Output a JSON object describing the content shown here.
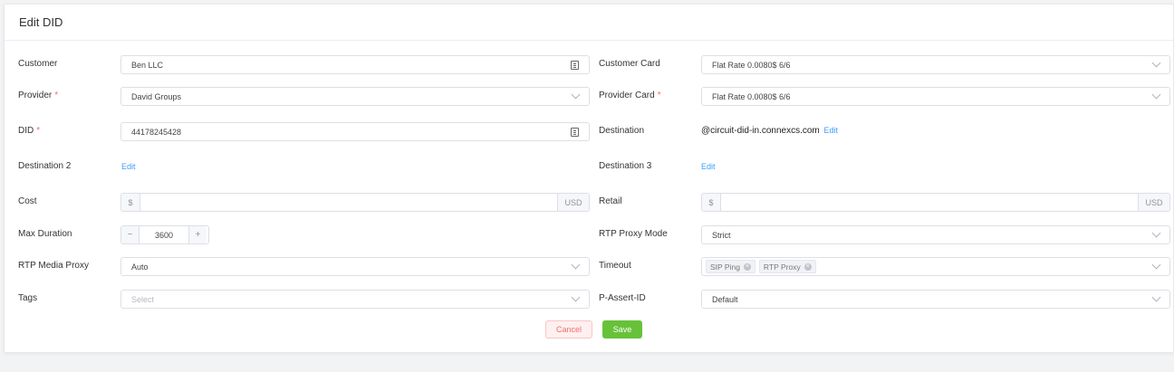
{
  "header": {
    "title": "Edit DID"
  },
  "left": {
    "customer": {
      "label": "Customer",
      "value": "Ben LLC"
    },
    "provider": {
      "label": "Provider",
      "required": "*",
      "value": "David Groups"
    },
    "did": {
      "label": "DID",
      "required": "*",
      "value": "44178245428"
    },
    "destination2": {
      "label": "Destination 2",
      "link": "Edit"
    },
    "cost": {
      "label": "Cost",
      "prefix": "$",
      "value": "",
      "suffix": "USD"
    },
    "max_duration": {
      "label": "Max Duration",
      "minus": "−",
      "value": "3600",
      "plus": "+"
    },
    "rtp_media_proxy": {
      "label": "RTP Media Proxy",
      "value": "Auto"
    },
    "tags": {
      "label": "Tags",
      "placeholder": "Select"
    }
  },
  "right": {
    "customer_card": {
      "label": "Customer Card",
      "value": "Flat Rate 0.0080$ 6/6"
    },
    "provider_card": {
      "label": "Provider Card",
      "required": "*",
      "value": "Flat Rate 0.0080$ 6/6"
    },
    "destination": {
      "label": "Destination",
      "value": "@circuit-did-in.connexcs.com",
      "link": "Edit"
    },
    "destination3": {
      "label": "Destination 3",
      "link": "Edit"
    },
    "retail": {
      "label": "Retail",
      "prefix": "$",
      "value": "",
      "suffix": "USD"
    },
    "rtp_proxy_mode": {
      "label": "RTP Proxy Mode",
      "value": "Strict"
    },
    "timeout": {
      "label": "Timeout",
      "tags": [
        "SIP Ping",
        "RTP Proxy"
      ]
    },
    "p_assert_id": {
      "label": "P-Assert-ID",
      "value": "Default"
    }
  },
  "actions": {
    "cancel": "Cancel",
    "save": "Save"
  },
  "colors": {
    "link": "#409eff",
    "required": "#f56c6c",
    "save": "#67c23a",
    "cancel_text": "#f56c6c"
  }
}
